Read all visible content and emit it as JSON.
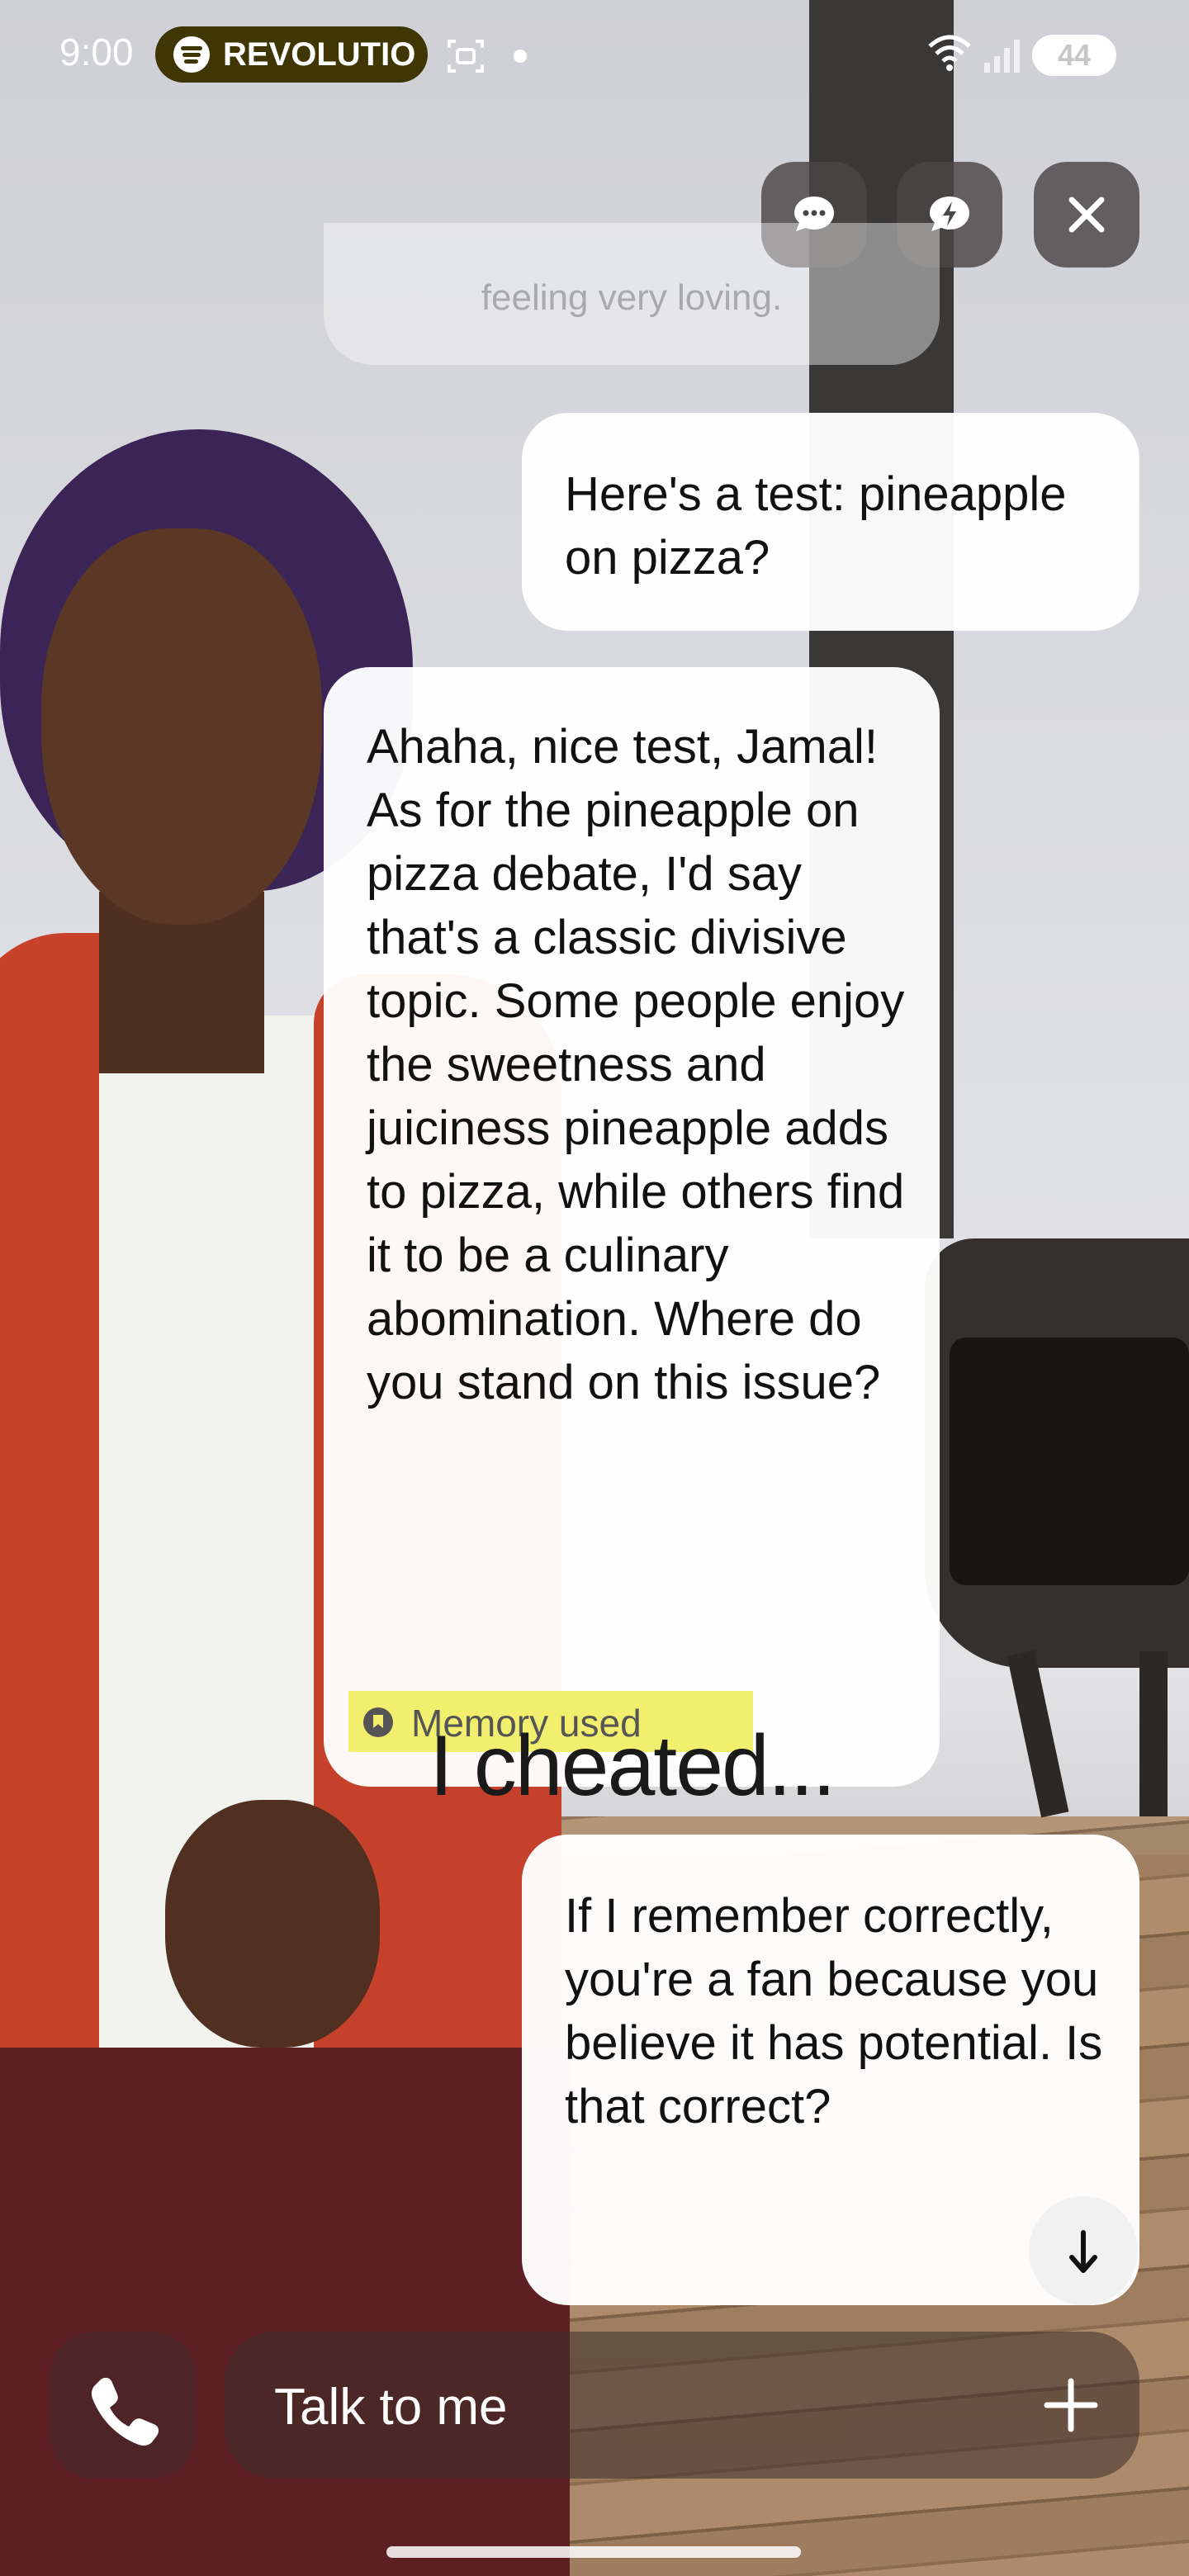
{
  "status_bar": {
    "time": "9:00",
    "now_playing_app": "spotify-icon",
    "now_playing_text": "REVOLUTIO",
    "battery_level": "44",
    "icons": [
      "screenshot-icon",
      "dot-icon",
      "wifi-icon",
      "signal-icon",
      "battery-charging-icon"
    ]
  },
  "top_actions": [
    {
      "name": "chat-mode-button",
      "icon": "chat-bubble-icon"
    },
    {
      "name": "quick-reply-button",
      "icon": "lightning-bubble-icon"
    },
    {
      "name": "close-button",
      "icon": "close-icon"
    }
  ],
  "messages": {
    "previous_partial": "feeling very loving.",
    "user_1": "Here's a test: pineapple on pizza?",
    "ai_1": "Ahaha, nice test, Jamal! As for the pineapple on pizza debate, I'd say that's a classic divisive topic. Some people enjoy the sweetness and juiciness pineapple adds to pizza, while others find it to be a culinary abomination. Where do you stand on this issue?",
    "ai_1_badge": "Memory used",
    "overlay_caption": "I cheated...",
    "user_2": "If I remember correctly, you're a fan because you believe it has potential. Is that correct?"
  },
  "composer": {
    "placeholder": "Talk to me",
    "call_icon": "phone-icon",
    "add_icon": "plus-icon",
    "scroll_icon": "arrow-down-icon"
  },
  "colors": {
    "memory_highlight": "#f2ef6e",
    "now_playing_pill": "#3f3604",
    "bubble": "#ffffff"
  }
}
